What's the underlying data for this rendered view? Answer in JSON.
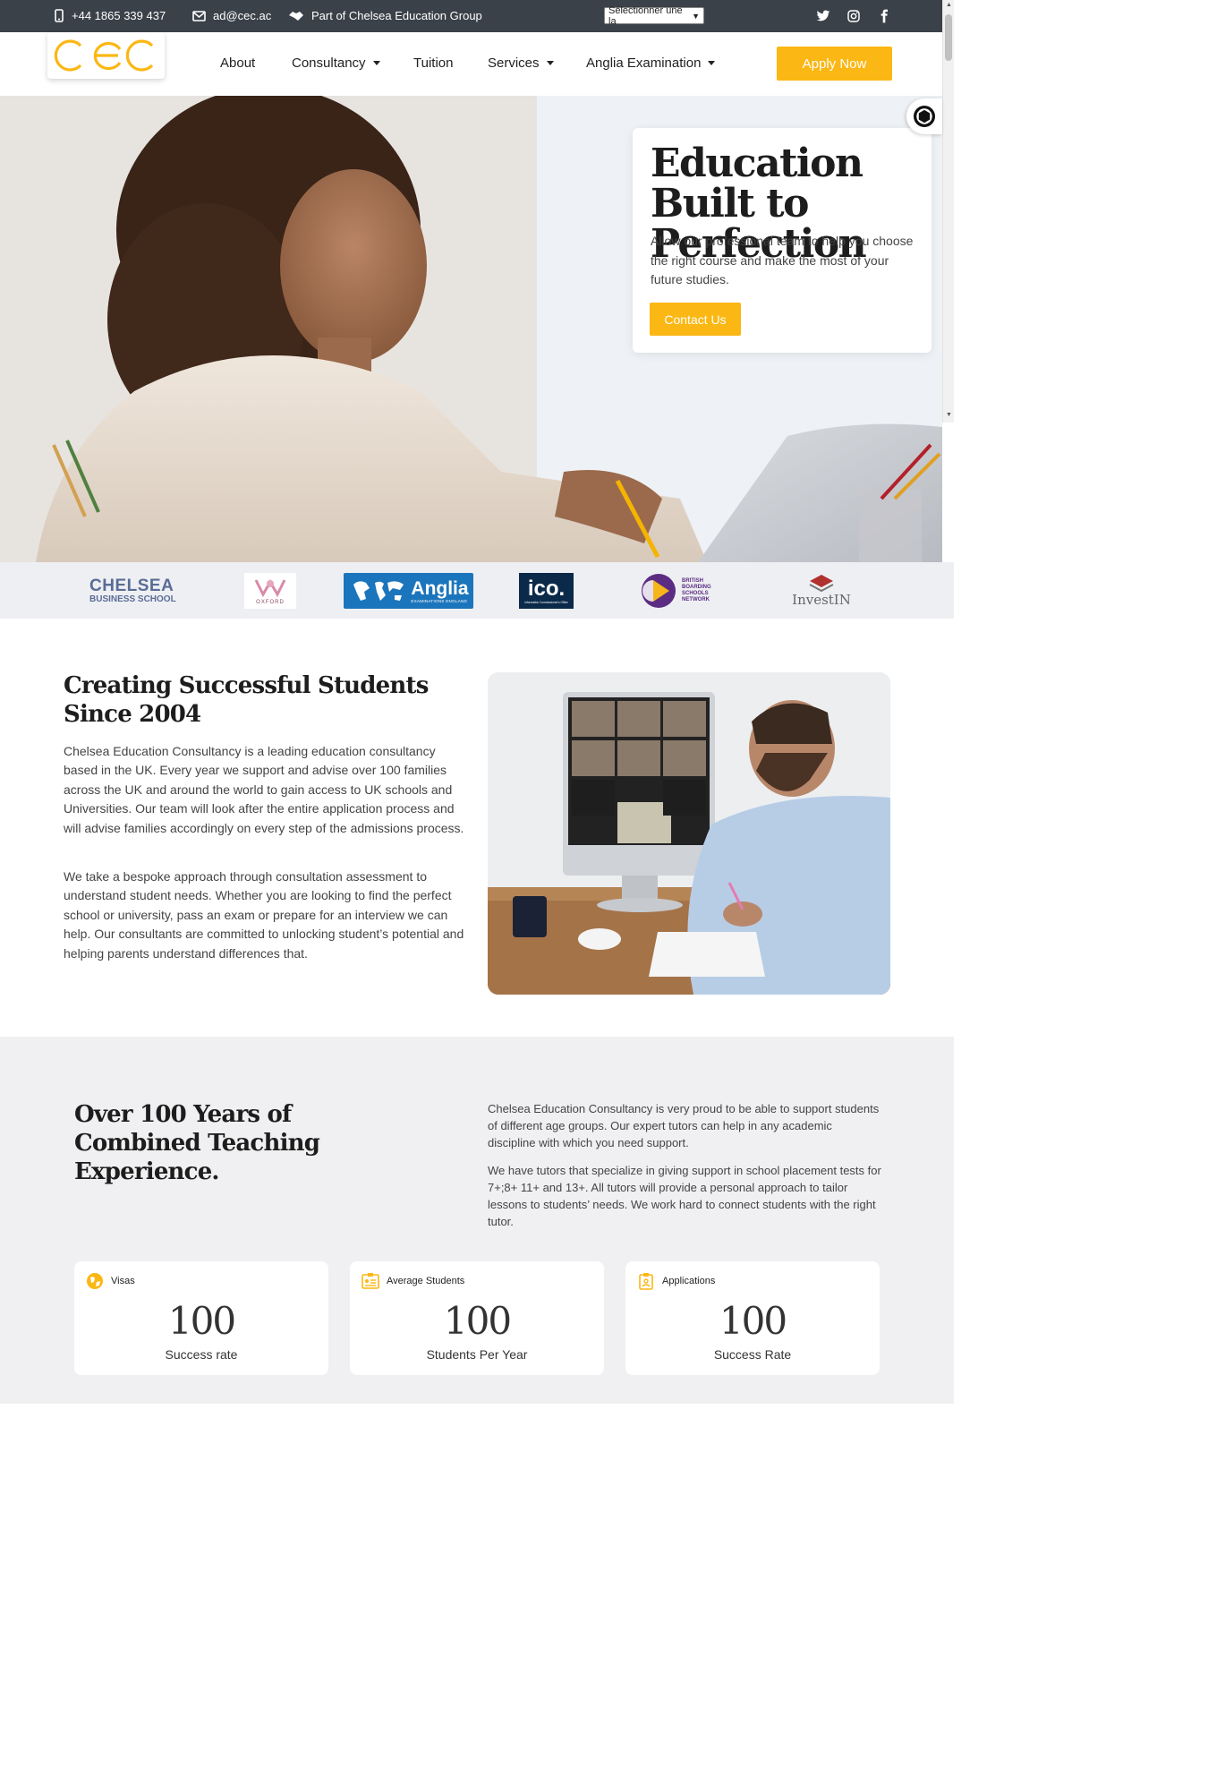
{
  "topbar": {
    "phone": "+44 1865 339 437",
    "email": "ad@cec.ac",
    "group": "Part of Chelsea Education Group",
    "language_select": "Sélectionner une la"
  },
  "header": {
    "logo_text": "CEC",
    "nav": {
      "about": "About",
      "consultancy": "Consultancy",
      "tuition": "Tuition",
      "services": "Services",
      "anglia": "Anglia Examination"
    },
    "apply": "Apply Now"
  },
  "hero": {
    "title": "Education Built to Perfection",
    "text": "Allow our professional team to help you choose the right course and make the most of your future studies.",
    "cta": "Contact Us"
  },
  "partners": {
    "chelsea_line1": "CHELSEA",
    "chelsea_line2": "BUSINESS SCHOOL",
    "oxford": "OXFORD",
    "anglia": "Anglia",
    "anglia_sub": "EXAMINATIONS ENGLAND",
    "ico": "ico.",
    "ico_sub": "Information Commissioner's Office",
    "bbsn": "BRITISH BOARDING SCHOOLS NETWORK",
    "investin": "InvestIN"
  },
  "about": {
    "title": "Creating Successful Students Since 2004",
    "p1": "Chelsea Education Consultancy is a leading education consultancy based in the UK. Every year we support and advise over 100 families across the UK and around the world to gain access to UK schools and Universities. Our team will look after the entire application process and will advise families accordingly on every step of the admissions process.",
    "p2": "We take a bespoke approach through consultation assessment to understand student needs. Whether you are looking to find the perfect school or university, pass an exam or prepare for an interview we can help. Our consultants are committed to unlocking student’s potential and helping parents understand differences that."
  },
  "experience": {
    "title": "Over 100 Years of Combined Teaching Experience.",
    "p1": "Chelsea Education Consultancy is very proud to be able to support students of different age groups. Our expert tutors can help in any academic discipline with which you need support.",
    "p2": "We have tutors that specialize in giving support in school placement tests for 7+;8+ 11+ and 13+. All tutors will provide a personal approach to tailor lessons to students’ needs. We work hard to connect students with the right tutor."
  },
  "stats": [
    {
      "label": "Visas",
      "value": "100",
      "sub": "Success rate",
      "icon": "globe-icon"
    },
    {
      "label": "Average Students",
      "value": "100",
      "sub": "Students Per Year",
      "icon": "id-card-icon"
    },
    {
      "label": "Applications",
      "value": "100",
      "sub": "Success Rate",
      "icon": "clipboard-icon"
    }
  ],
  "colors": {
    "accent": "#fbb713",
    "topbar": "#3a4149",
    "anglia_blue": "#1b75bc",
    "ico_navy": "#0b2a4a"
  }
}
